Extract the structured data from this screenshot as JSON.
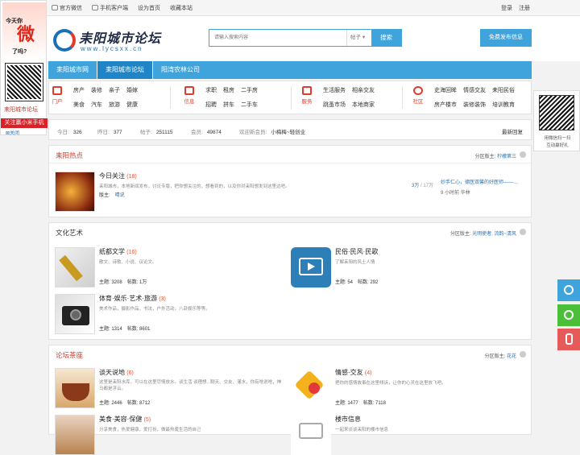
{
  "topbar": {
    "wechat": "官方微信",
    "mobile": "手机客户端",
    "homepage": "设为首页",
    "favorite": "收藏本站",
    "login": "登录",
    "register": "注册"
  },
  "header": {
    "logo_title": "耒阳城市论坛",
    "logo_url": "www.lycsxx.cn",
    "search_placeholder": "请输入搜索内容",
    "search_scope": "帖子",
    "search_button": "搜索",
    "post_button": "免费发布信息"
  },
  "nav": {
    "items": [
      "耒阳城市网",
      "耒阳城市论坛",
      "阳湾农林公司"
    ]
  },
  "categories": [
    {
      "label": "门户",
      "items": [
        "房产",
        "装修",
        "亲子",
        "婚嫁",
        "美食",
        "汽车",
        "旅游",
        "健康"
      ]
    },
    {
      "label": "信息",
      "items": [
        "求职",
        "租房",
        "二手房",
        "招聘",
        "拼车",
        "二手车"
      ]
    },
    {
      "label": "服务",
      "items": [
        "生活服务",
        "相亲交友",
        "跳蚤市场",
        "本地商家"
      ]
    },
    {
      "label": "社区",
      "items": [
        "史海回眸",
        "情感交友",
        "耒阳民俗",
        "房产楼市",
        "装修装饰",
        "培训教育"
      ]
    }
  ],
  "stats": {
    "today_label": "今日:",
    "today": "326",
    "yesterday_label": "昨日:",
    "yesterday": "377",
    "posts_label": "帖子:",
    "posts": "251115",
    "members_label": "会员:",
    "members": "49874",
    "welcome_label": "欢迎新会员:",
    "new_member": "小梅梅~轻创业",
    "latest": "最新回复"
  },
  "hot": {
    "title": "耒阳热点",
    "moderator_label": "分区版主:",
    "moderator": "柠檬第三",
    "forum_name": "今日关注",
    "forum_count": "(18)",
    "forum_desc": "耒阳城市，本地新闻发布，讨论专版，把你想关注的，想看到的，以及你对耒阳想发到这里边吧。",
    "forum_mod_label": "版主:",
    "forum_mod": "晴说",
    "count_main": "3万",
    "count_sub": "/ 17万",
    "latest_title": "妙手仁心，德医双馨的好医师——…",
    "latest_meta": "9 小时前 华林"
  },
  "arts": {
    "title": "文化艺术",
    "moderator_label": "分区版主:",
    "moderator": "光明使者, 流韵~清风",
    "forums": [
      {
        "name": "纸都文学",
        "count": "(16)",
        "desc": "散文、诗歌、小说、议论文。",
        "topics": "主题: 3208",
        "posts": "帖数: 1万"
      },
      {
        "name": "民俗·民风·民歌",
        "count": "",
        "desc": "了解耒阳的风土人情",
        "topics": "主题: 54",
        "posts": "帖数: 292"
      },
      {
        "name": "体育·娱乐·艺术·旅游",
        "count": "(3)",
        "desc": "美术作品，摄影作品，书法，户外活动，八卦娱乐等等。",
        "topics": "主题: 1314",
        "posts": "帖数: 8601"
      }
    ]
  },
  "tea": {
    "title": "论坛茶座",
    "moderator_label": "分区版主:",
    "moderator": "花花",
    "forums": [
      {
        "name": "谈天说地",
        "count": "(6)",
        "desc": "这里是耒阳水库，可以在这里尽情放水。谈生活 谈理想...聊天、交友、灌水，你有啥说啥，神马都是浮云。",
        "topics": "主题: 2446",
        "posts": "帖数: 8712"
      },
      {
        "name": "情感·交友",
        "count": "(4)",
        "desc": "把你的感情故事在这里倾诉，让你的心灵在这里放飞吧。",
        "topics": "主题: 1477",
        "posts": "帖数: 7118"
      },
      {
        "name": "美食·美容·保健",
        "count": "(5)",
        "desc": "分享美食，热爱健康，爱打扮，做最热爱生活的自己",
        "topics": "",
        "posts": ""
      },
      {
        "name": "楼市信息",
        "count": "",
        "desc": "一起来谈谈耒阳的楼市信息",
        "topics": "",
        "posts": ""
      }
    ]
  },
  "left_ad": {
    "headline": "今天你",
    "big": "微",
    "sub": "了吗?",
    "label": "耒阳城市论坛",
    "banner": "关注赢小米手机",
    "close": "关闭"
  },
  "right_qr": {
    "line1": "用微信扫一扫",
    "line2": "互动赢好礼"
  },
  "float_colors": {
    "service": "#3fa4dc",
    "wechat": "#4cbf3a",
    "phone": "#e75a5a"
  }
}
